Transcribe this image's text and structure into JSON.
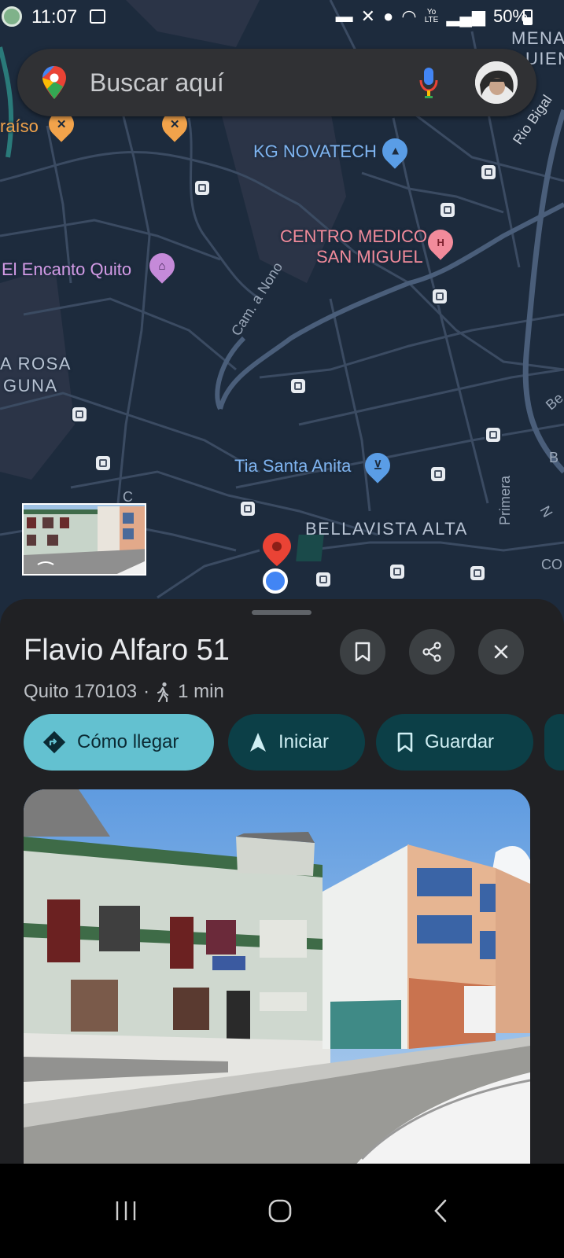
{
  "status_bar": {
    "time": "11:07",
    "carrier_tag": "Yo LTE",
    "battery": "50%"
  },
  "search": {
    "placeholder": "Buscar aquí"
  },
  "map": {
    "labels": {
      "corner_top_right": "MENA",
      "corner_top_right_2": "UIEN",
      "paraiso": "raíso",
      "kg_novatech": "KG NOVATECH",
      "centro_medico_1": "CENTRO MEDICO",
      "centro_medico_2": "SAN MIGUEL",
      "el_encanto": "El Encanto Quito",
      "rosa": "A ROSA",
      "guna": "GUNA",
      "cam_nono": "Cam. a Nono",
      "rio_bigal": "Rio Bigal",
      "tia_santa_anita": "Tia Santa Anita",
      "bellavista_alta": "BELLAVISTA ALTA",
      "primera": "Primera",
      "c_label": "C",
      "co_label": "CO",
      "be_label": "Be",
      "b_label": "B",
      "n_label": "N"
    },
    "colors": {
      "background": "#1d2b3d",
      "road": "#3a4a60",
      "poi_orange": "#f2a34b",
      "poi_blue": "#5a9de6",
      "poi_pink": "#f28b9b",
      "poi_purple": "#c58ad9",
      "marker": "#ea4335"
    }
  },
  "place": {
    "title": "Flavio Alfaro 51",
    "address": "Quito 170103",
    "separator": "·",
    "walk_time": "1 min"
  },
  "actions": {
    "directions": "Cómo llegar",
    "start": "Iniciar",
    "save": "Guardar"
  }
}
